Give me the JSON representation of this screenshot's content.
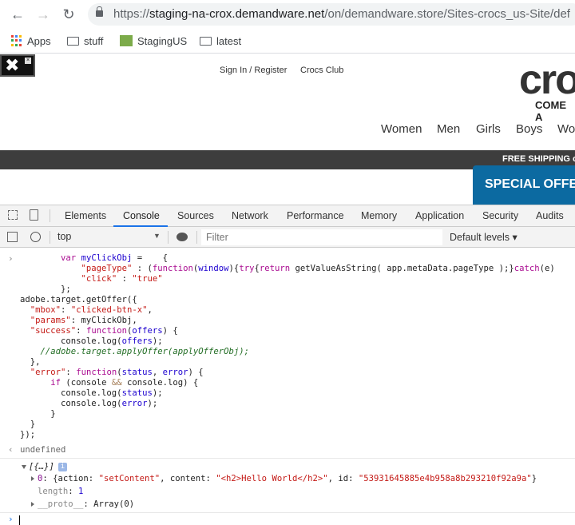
{
  "browser": {
    "url_scheme": "https://",
    "url_host": "staging-na-crox.demandware.net",
    "url_path": "/on/demandware.store/Sites-crocs_us-Site/def",
    "bookmarks": [
      {
        "label": "Apps",
        "icon": "apps-grid-icon"
      },
      {
        "label": "stuff",
        "icon": "folder-icon"
      },
      {
        "label": "StagingUS",
        "icon": "site-favicon"
      },
      {
        "label": "latest",
        "icon": "folder-icon"
      }
    ]
  },
  "site": {
    "top_links": [
      "Sign In / Register",
      "Crocs Club"
    ],
    "logo": "cro",
    "slogan": "COME A",
    "categories": [
      "Women",
      "Men",
      "Girls",
      "Boys",
      "Wo"
    ],
    "shipping_banner": "FREE SHIPPING o",
    "special_offer": "SPECIAL OFFER"
  },
  "devtools": {
    "tabs": [
      "Elements",
      "Console",
      "Sources",
      "Network",
      "Performance",
      "Memory",
      "Application",
      "Security",
      "Audits"
    ],
    "active_tab": "Console",
    "context": "top",
    "filter_placeholder": "Filter",
    "levels": "Default levels ▾"
  },
  "console": {
    "input_lines": [
      [
        [
          "p",
          "        "
        ],
        [
          "k",
          "var"
        ],
        [
          "p",
          " "
        ],
        [
          "v",
          "myClickObj"
        ],
        [
          "p",
          " =    {"
        ]
      ],
      [
        [
          "p",
          "            "
        ],
        [
          "s",
          "\"pageType\""
        ],
        [
          "p",
          " : ("
        ],
        [
          "k",
          "function"
        ],
        [
          "p",
          "("
        ],
        [
          "v",
          "window"
        ],
        [
          "p",
          "){"
        ],
        [
          "k",
          "try"
        ],
        [
          "p",
          "{"
        ],
        [
          "k",
          "return"
        ],
        [
          "p",
          " getValueAsString( app.metaData.pageType );}"
        ],
        [
          "k",
          "catch"
        ],
        [
          "p",
          "(e)"
        ]
      ],
      [
        [
          "p",
          "            "
        ],
        [
          "s",
          "\"click\""
        ],
        [
          "p",
          " : "
        ],
        [
          "s",
          "\"true\""
        ]
      ],
      [
        [
          "p",
          "        };"
        ]
      ],
      [
        [
          "p",
          "adobe.target.getOffer({"
        ]
      ],
      [
        [
          "p",
          "  "
        ],
        [
          "s",
          "\"mbox\""
        ],
        [
          "p",
          ": "
        ],
        [
          "s",
          "\"clicked-btn-x\""
        ],
        [
          "p",
          ","
        ]
      ],
      [
        [
          "p",
          "  "
        ],
        [
          "s",
          "\"params\""
        ],
        [
          "p",
          ": myClickObj,"
        ]
      ],
      [
        [
          "p",
          "  "
        ],
        [
          "s",
          "\"success\""
        ],
        [
          "p",
          ": "
        ],
        [
          "k",
          "function"
        ],
        [
          "p",
          "("
        ],
        [
          "v",
          "offers"
        ],
        [
          "p",
          ") {"
        ]
      ],
      [
        [
          "p",
          "        console.log("
        ],
        [
          "v",
          "offers"
        ],
        [
          "p",
          ");"
        ]
      ],
      [
        [
          "c",
          "    //adobe.target.applyOffer(applyOfferObj);"
        ]
      ],
      [
        [
          "p",
          "  },"
        ]
      ],
      [
        [
          "p",
          "  "
        ],
        [
          "s",
          "\"error\""
        ],
        [
          "p",
          ": "
        ],
        [
          "k",
          "function"
        ],
        [
          "p",
          "("
        ],
        [
          "v",
          "status"
        ],
        [
          "p",
          ", "
        ],
        [
          "v",
          "error"
        ],
        [
          "p",
          ") {"
        ]
      ],
      [
        [
          "p",
          "      "
        ],
        [
          "k",
          "if"
        ],
        [
          "p",
          " (console "
        ],
        [
          "o",
          "&&"
        ],
        [
          "p",
          " console.log) {"
        ]
      ],
      [
        [
          "p",
          "        console.log("
        ],
        [
          "v",
          "status"
        ],
        [
          "p",
          ");"
        ]
      ],
      [
        [
          "p",
          "        console.log("
        ],
        [
          "v",
          "error"
        ],
        [
          "p",
          ");"
        ]
      ],
      [
        [
          "p",
          "      }"
        ]
      ],
      [
        [
          "p",
          "  }"
        ]
      ],
      [
        [
          "p",
          "});"
        ]
      ]
    ],
    "result": "undefined",
    "array_summary": "[{…}]",
    "item0": [
      [
        "pk",
        "0"
      ],
      [
        "p",
        ": {action: "
      ],
      [
        "s",
        "\"setContent\""
      ],
      [
        "p",
        ", content: "
      ],
      [
        "s",
        "\"<h2>Hello World</h2>\""
      ],
      [
        "p",
        ", id: "
      ],
      [
        "s",
        "\"53931645885e4b958a8b293210f92a9a\""
      ],
      [
        "p",
        "}"
      ]
    ],
    "length": [
      [
        "ln",
        "length"
      ],
      [
        "p",
        ": "
      ],
      [
        "v",
        "1"
      ]
    ],
    "proto": [
      [
        "ln",
        "__proto__"
      ],
      [
        "p",
        ": Array(0)"
      ]
    ]
  }
}
